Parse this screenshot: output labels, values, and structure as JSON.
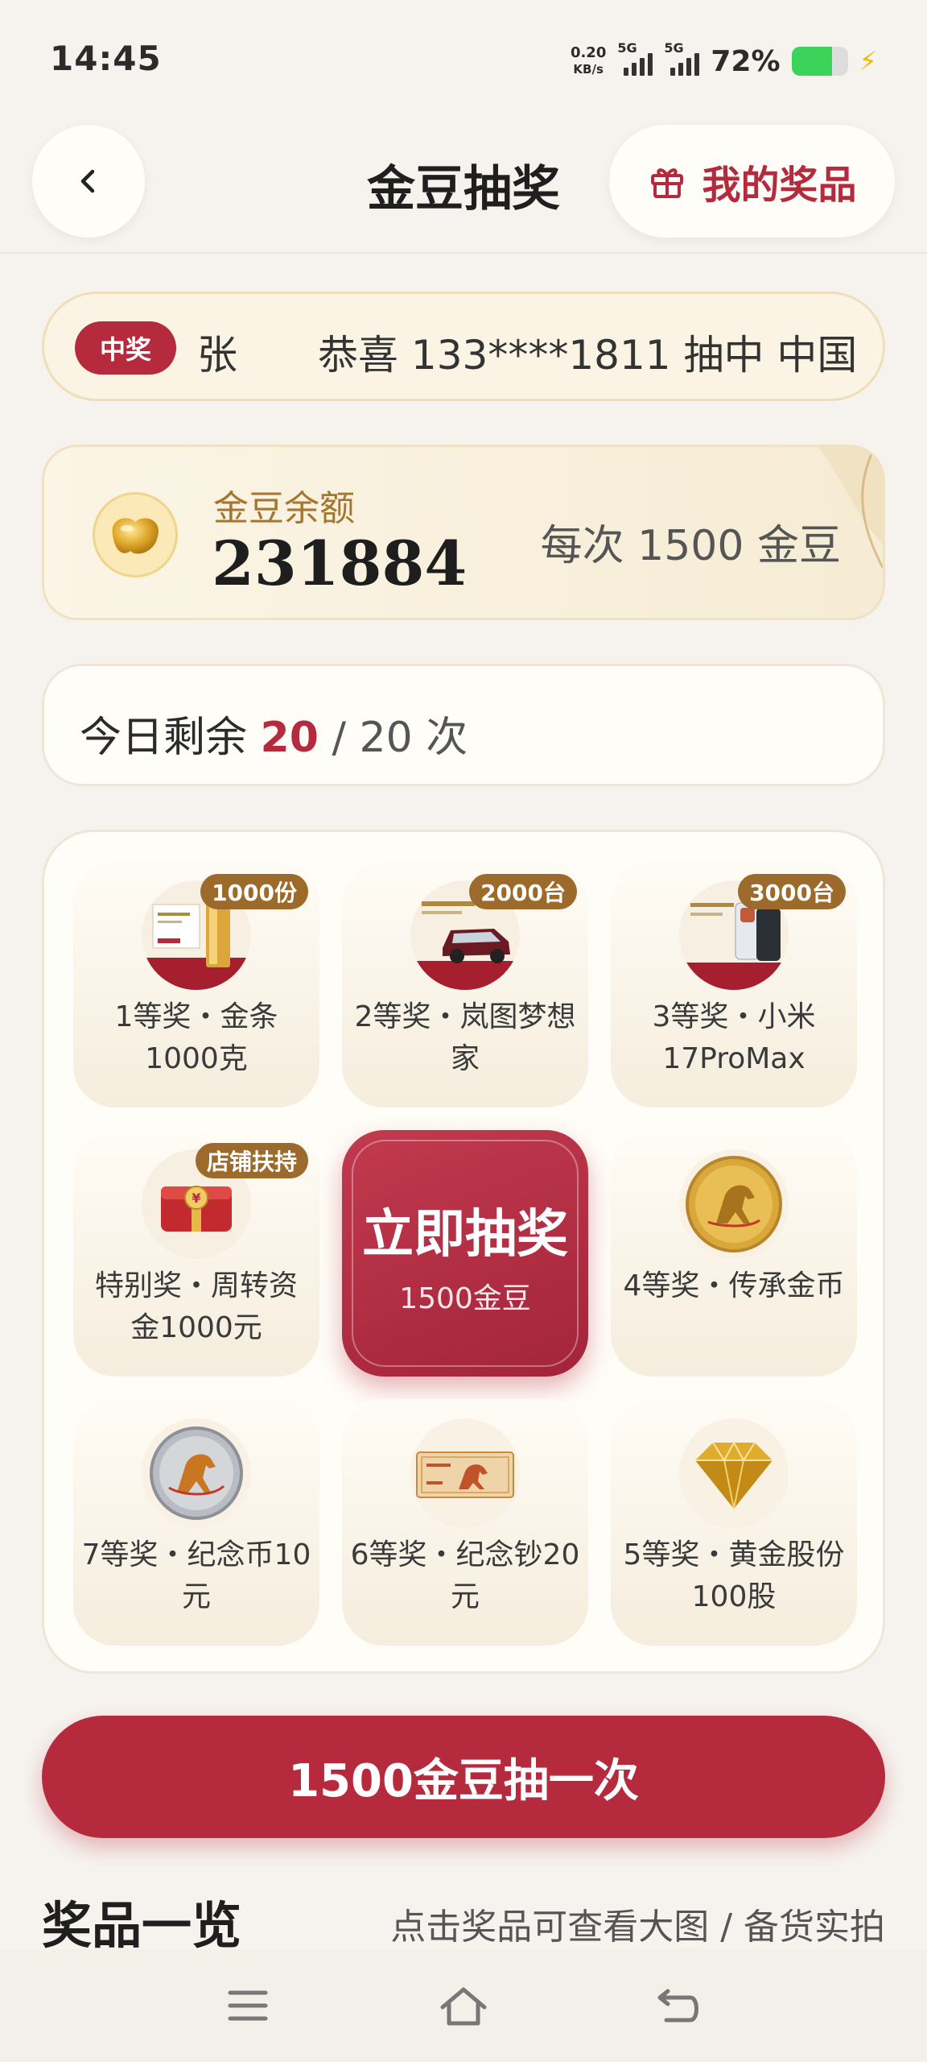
{
  "status_bar": {
    "time": "14:45",
    "net_speed_value": "0.20",
    "net_speed_unit": "KB/s",
    "signal1_tag": "5G",
    "signal2_tag": "5G",
    "battery_percent": "72%",
    "battery_level": 0.72
  },
  "header": {
    "title": "金豆抽奖",
    "my_prizes_label": "我的奖品"
  },
  "ticker": {
    "badge": "中奖",
    "name": "张",
    "message": "恭喜 133****1811 抽中 中国"
  },
  "balance": {
    "label": "金豆余额",
    "value": "231884",
    "per_draw": "每次 1500 金豆"
  },
  "remaining": {
    "prefix": "今日剩余",
    "left": "20",
    "separator": "/",
    "total": "20 次"
  },
  "grid": {
    "cells": [
      {
        "label": "1等奖・金条1000克",
        "tag": "1000份"
      },
      {
        "label": "2等奖・岚图梦想家",
        "tag": "2000台"
      },
      {
        "label": "3等奖・小米17ProMax",
        "tag": "3000台"
      },
      {
        "label": "特别奖・周转资金1000元",
        "tag": "店铺扶持"
      },
      {
        "label": "4等奖・传承金币",
        "tag": ""
      },
      {
        "label": "7等奖・纪念币10元",
        "tag": ""
      },
      {
        "label": "6等奖・纪念钞20元",
        "tag": ""
      },
      {
        "label": "5等奖・黄金股份100股",
        "tag": ""
      }
    ],
    "draw_title": "立即抽奖",
    "draw_sub": "1500金豆"
  },
  "draw_button": "1500金豆抽一次",
  "prize_list": {
    "title": "奖品一览",
    "hint": "点击奖品可查看大图 / 备货实拍"
  },
  "colors": {
    "accent": "#b52a3c",
    "gold": "#a4762e",
    "background": "#f6f3ee"
  }
}
